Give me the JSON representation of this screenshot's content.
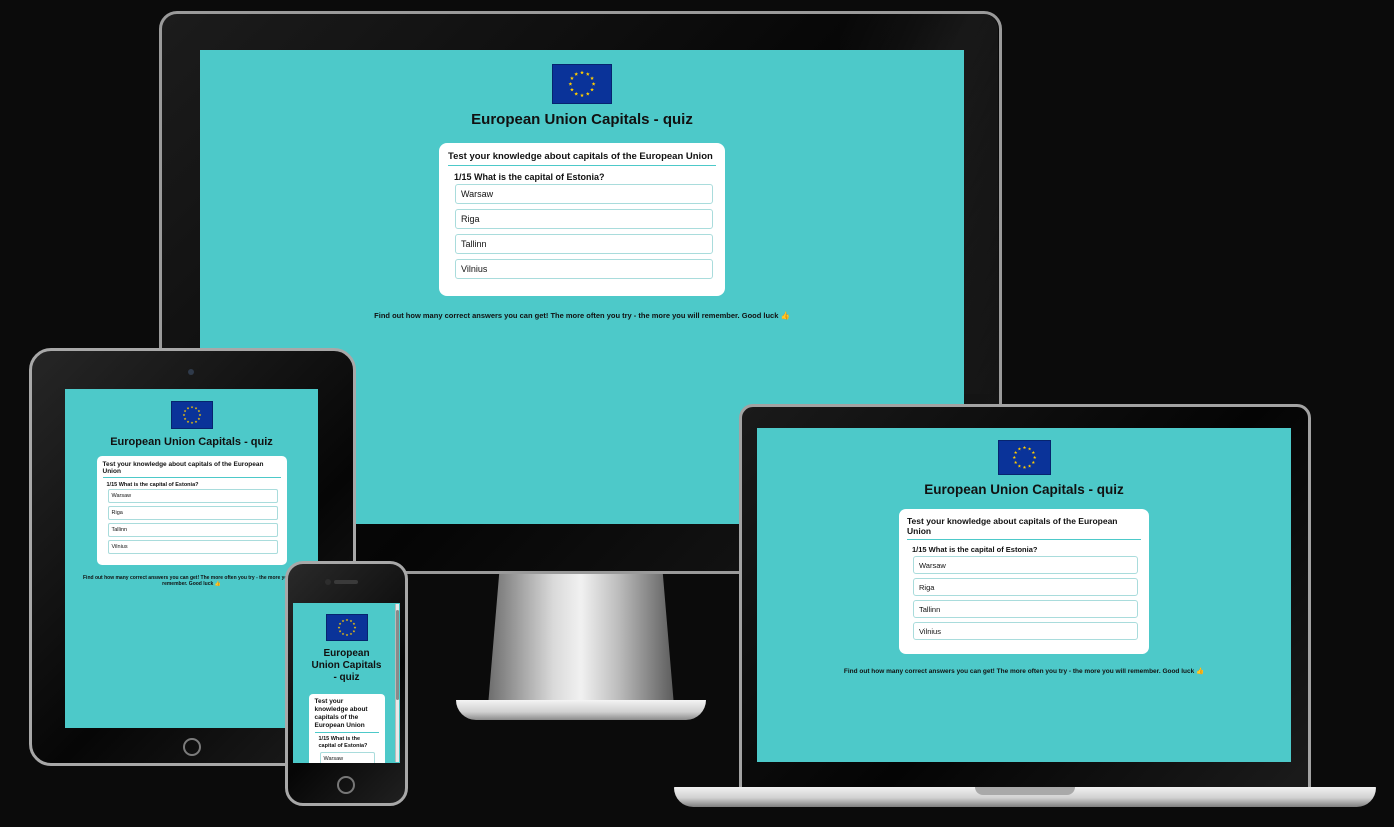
{
  "quiz": {
    "title": "European Union Capitals - quiz",
    "subtitle": "Test your knowledge about capitals of the European Union",
    "question": "1/15 What is the capital of Estonia?",
    "answers": [
      "Warsaw",
      "Riga",
      "Tallinn",
      "Vilnius"
    ],
    "footer": "Find out how many correct answers you can get! The more often you try - the more you will remember. Good luck 👍"
  },
  "colors": {
    "page_background": "#4dc9c9",
    "card_background": "#ffffff",
    "flag_blue": "#0a3399",
    "flag_star": "#ffcc00",
    "device_background": "#0b0b0b"
  },
  "icons": {
    "flag": "eu-flag-icon",
    "thumbs_up": "thumbs-up-icon"
  }
}
